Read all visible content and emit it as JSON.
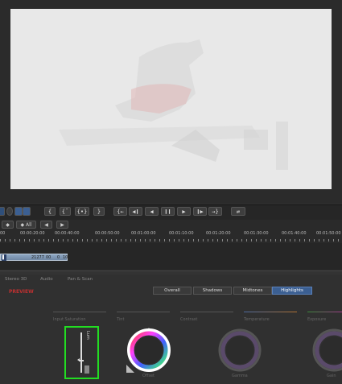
{
  "transport": {
    "buttons": [
      "{",
      "{ˉ",
      "{•}",
      "}",
      "{←",
      "◀❙",
      "◀",
      "❙❙",
      "▶",
      "❙▶",
      "→}",
      "⇄"
    ]
  },
  "subbar": {
    "all_label": "All"
  },
  "ruler": {
    "labels": [
      "00",
      "00:00:20:00",
      "00:00:40:00",
      "00:00:50:00",
      "00:01:00:00",
      "00:01:10:00",
      "00:01:20:00",
      "00:01:30:00",
      "00:01:40:00",
      "00:01:50:00"
    ]
  },
  "clip": {
    "frame_count": "21277",
    "mid": "00",
    "right_a": "0",
    "right_b": "10"
  },
  "panel": {
    "tabs": [
      "Stereo 3D",
      "Audio",
      "Pan & Scan"
    ],
    "preview_label": "PREVIEW",
    "ranges": [
      "Overall",
      "Shadows",
      "Midtones",
      "Highlights"
    ],
    "active_range": "Highlights",
    "slider_labels": [
      "Input Saturation",
      "Tint",
      "Contrast",
      "Temperature",
      "Exposure"
    ],
    "lum_label": "Lum",
    "wheel_labels": [
      "Offset",
      "Gamma",
      "Gain"
    ]
  },
  "colors": {
    "accent_active": "#3b5f92",
    "highlight_box": "#22dd22",
    "preview_red": "#c03030"
  }
}
